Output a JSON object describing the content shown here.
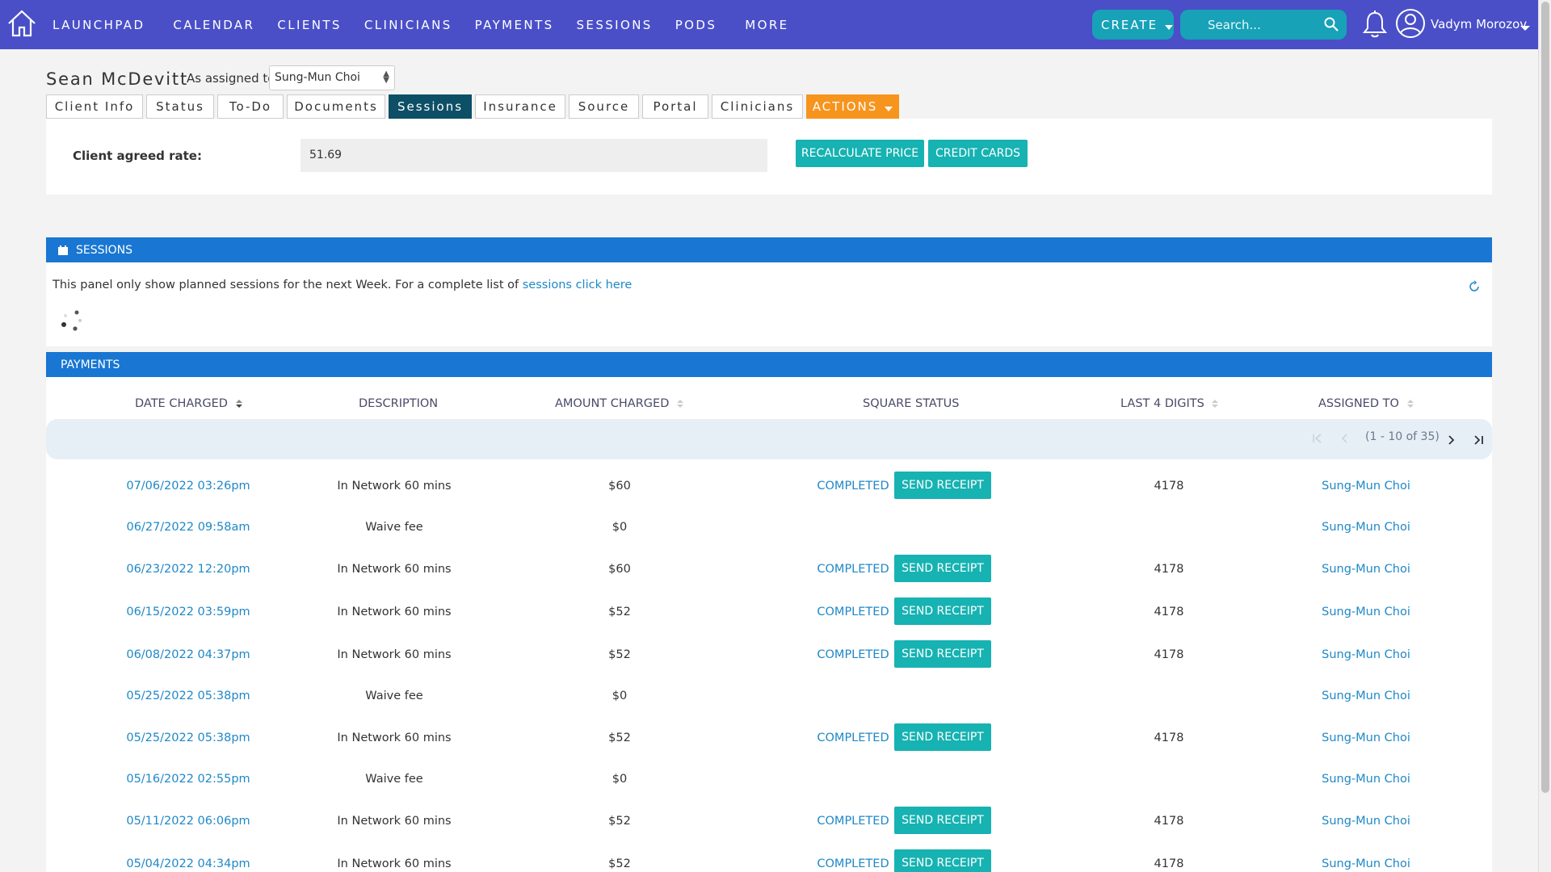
{
  "nav": {
    "items": [
      "LAUNCHPAD",
      "CALENDAR",
      "CLIENTS",
      "CLINICIANS",
      "PAYMENTS",
      "SESSIONS",
      "PODS",
      "MORE"
    ],
    "create_label": "CREATE",
    "search_placeholder": "Search...",
    "user_name": "Vadym Morozov"
  },
  "client": {
    "name": "Sean McDevitt",
    "assigned_label": "As assigned to:",
    "assigned_value": "Sung-Mun Choi"
  },
  "tabs": [
    {
      "label": "Client Info"
    },
    {
      "label": "Status"
    },
    {
      "label": "To-Do"
    },
    {
      "label": "Documents"
    },
    {
      "label": "Sessions"
    },
    {
      "label": "Insurance"
    },
    {
      "label": "Source"
    },
    {
      "label": "Portal"
    },
    {
      "label": "Clinicians"
    },
    {
      "label": "ACTIONS"
    }
  ],
  "active_tab": "Sessions",
  "rate": {
    "label": "Client agreed rate:",
    "value": "51.69",
    "recalc_label": "RECALCULATE PRICE",
    "credit_label": "CREDIT CARDS"
  },
  "sessions": {
    "title": "SESSIONS",
    "text": "This panel only show planned sessions for the next Week. For a complete list of ",
    "link": "sessions click here"
  },
  "payments": {
    "title": "PAYMENTS",
    "columns": [
      "DATE CHARGED",
      "DESCRIPTION",
      "AMOUNT CHARGED",
      "SQUARE STATUS",
      "LAST 4 DIGITS",
      "ASSIGNED TO"
    ],
    "pager_text": "(1 - 10 of 35)",
    "send_label": "SEND RECEIPT",
    "rows": [
      {
        "date": "07/06/2022 03:26pm",
        "desc": "In Network 60 mins",
        "amount": "$60",
        "status": "COMPLETED",
        "digits": "4178",
        "assigned": "Sung-Mun Choi"
      },
      {
        "date": "06/27/2022 09:58am",
        "desc": "Waive fee",
        "amount": "$0",
        "status": "",
        "digits": "",
        "assigned": "Sung-Mun Choi"
      },
      {
        "date": "06/23/2022 12:20pm",
        "desc": "In Network 60 mins",
        "amount": "$60",
        "status": "COMPLETED",
        "digits": "4178",
        "assigned": "Sung-Mun Choi"
      },
      {
        "date": "06/15/2022 03:59pm",
        "desc": "In Network 60 mins",
        "amount": "$52",
        "status": "COMPLETED",
        "digits": "4178",
        "assigned": "Sung-Mun Choi"
      },
      {
        "date": "06/08/2022 04:37pm",
        "desc": "In Network 60 mins",
        "amount": "$52",
        "status": "COMPLETED",
        "digits": "4178",
        "assigned": "Sung-Mun Choi"
      },
      {
        "date": "05/25/2022 05:38pm",
        "desc": "Waive fee",
        "amount": "$0",
        "status": "",
        "digits": "",
        "assigned": "Sung-Mun Choi"
      },
      {
        "date": "05/25/2022 05:38pm",
        "desc": "In Network 60 mins",
        "amount": "$52",
        "status": "COMPLETED",
        "digits": "4178",
        "assigned": "Sung-Mun Choi"
      },
      {
        "date": "05/16/2022 02:55pm",
        "desc": "Waive fee",
        "amount": "$0",
        "status": "",
        "digits": "",
        "assigned": "Sung-Mun Choi"
      },
      {
        "date": "05/11/2022 06:06pm",
        "desc": "In Network 60 mins",
        "amount": "$52",
        "status": "COMPLETED",
        "digits": "4178",
        "assigned": "Sung-Mun Choi"
      },
      {
        "date": "05/04/2022 04:34pm",
        "desc": "In Network 60 mins",
        "amount": "$52",
        "status": "COMPLETED",
        "digits": "4178",
        "assigned": "Sung-Mun Choi"
      }
    ]
  },
  "colors": {
    "nav_bg": "#4a4fc8",
    "teal": "#17b2b2",
    "panel_blue": "#1976d2",
    "active_tab": "#0d4f66",
    "actions_orange": "#f7941d",
    "link_blue": "#1e88c8"
  }
}
